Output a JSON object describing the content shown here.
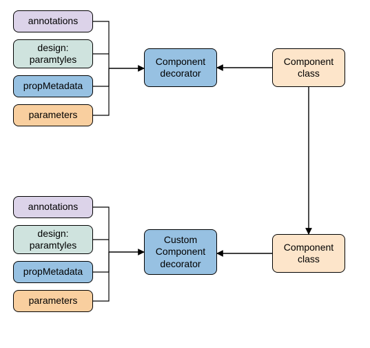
{
  "top": {
    "items": [
      {
        "label": "annotations"
      },
      {
        "label": "design:\nparamtyles"
      },
      {
        "label": "propMetadata"
      },
      {
        "label": "parameters"
      }
    ],
    "decorator": "Component\ndecorator",
    "class": "Component\nclass"
  },
  "bottom": {
    "items": [
      {
        "label": "annotations"
      },
      {
        "label": "design:\nparamtyles"
      },
      {
        "label": "propMetadata"
      },
      {
        "label": "parameters"
      }
    ],
    "decorator": "Custom\nComponent\ndecorator",
    "class": "Component\nclass"
  }
}
